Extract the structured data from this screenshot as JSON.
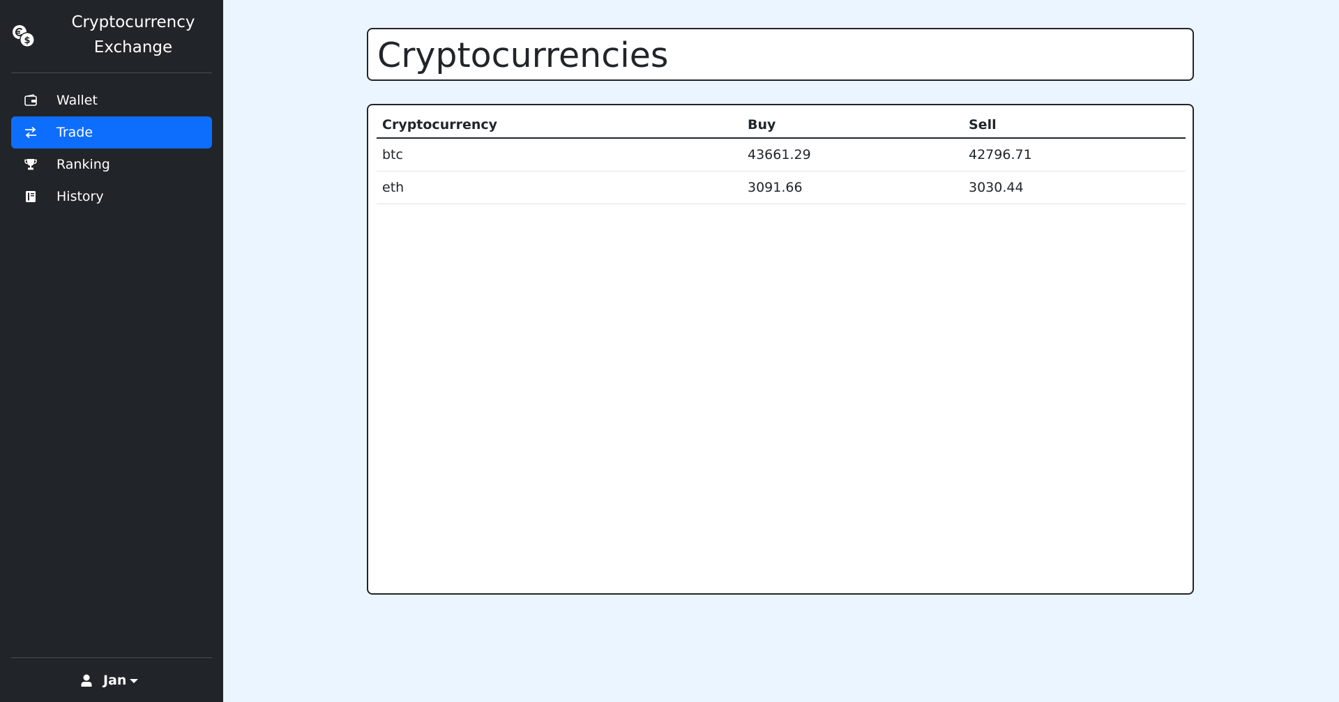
{
  "app": {
    "title": "Cryptocurrency Exchange",
    "brand_icon": "coins-icon"
  },
  "sidebar": {
    "items": [
      {
        "label": "Wallet",
        "icon": "wallet-icon",
        "active": false
      },
      {
        "label": "Trade",
        "icon": "arrows-exchange-icon",
        "active": true
      },
      {
        "label": "Ranking",
        "icon": "trophy-icon",
        "active": false
      },
      {
        "label": "History",
        "icon": "book-icon",
        "active": false
      }
    ],
    "user": {
      "name": "Jan",
      "icon": "user-icon"
    }
  },
  "colors": {
    "sidebar_bg": "#212529",
    "active_item": "#0d6efd",
    "page_bg": "#ebf5ff"
  },
  "main": {
    "page_title": "Cryptocurrencies",
    "table": {
      "headers": [
        "Cryptocurrency",
        "Buy",
        "Sell"
      ],
      "rows": [
        [
          "btc",
          "43661.29",
          "42796.71"
        ],
        [
          "eth",
          "3091.66",
          "3030.44"
        ]
      ]
    }
  }
}
